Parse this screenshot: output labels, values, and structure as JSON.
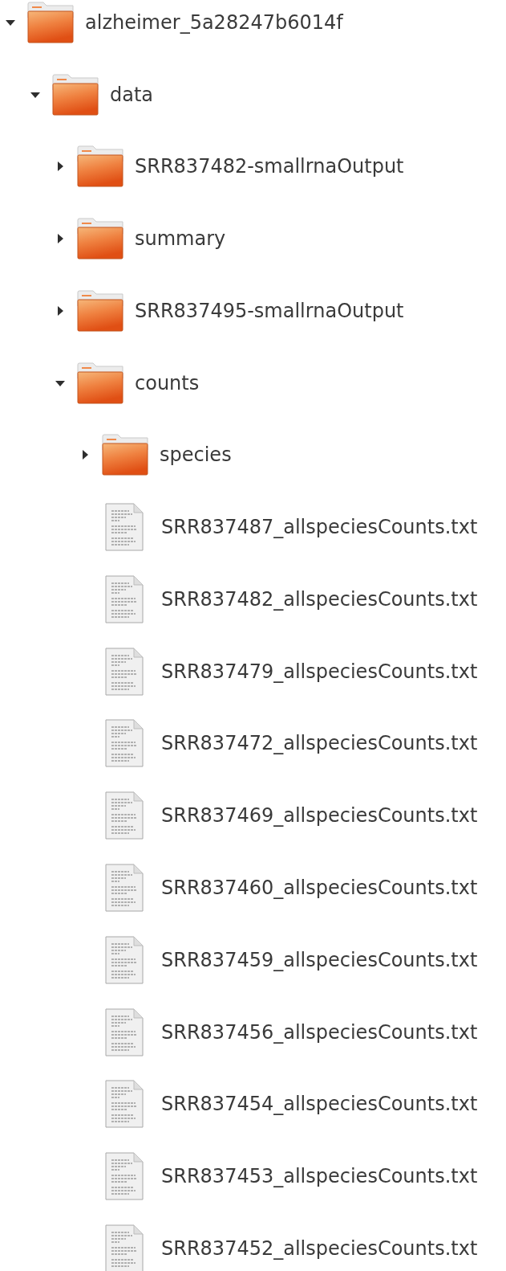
{
  "tree": [
    {
      "kind": "folder",
      "name": "alzheimer_5a28247b6014f",
      "expanded": true,
      "children": [
        {
          "kind": "folder",
          "name": "data",
          "expanded": true,
          "children": [
            {
              "kind": "folder",
              "name": "SRR837482-smallrnaOutput",
              "expanded": false
            },
            {
              "kind": "folder",
              "name": "summary",
              "expanded": false
            },
            {
              "kind": "folder",
              "name": "SRR837495-smallrnaOutput",
              "expanded": false
            },
            {
              "kind": "folder",
              "name": "counts",
              "expanded": true,
              "children": [
                {
                  "kind": "folder",
                  "name": "species",
                  "expanded": false
                },
                {
                  "kind": "file",
                  "name": "SRR837487_allspeciesCounts.txt"
                },
                {
                  "kind": "file",
                  "name": "SRR837482_allspeciesCounts.txt"
                },
                {
                  "kind": "file",
                  "name": "SRR837479_allspeciesCounts.txt"
                },
                {
                  "kind": "file",
                  "name": "SRR837472_allspeciesCounts.txt"
                },
                {
                  "kind": "file",
                  "name": "SRR837469_allspeciesCounts.txt"
                },
                {
                  "kind": "file",
                  "name": "SRR837460_allspeciesCounts.txt"
                },
                {
                  "kind": "file",
                  "name": "SRR837459_allspeciesCounts.txt"
                },
                {
                  "kind": "file",
                  "name": "SRR837456_allspeciesCounts.txt"
                },
                {
                  "kind": "file",
                  "name": "SRR837454_allspeciesCounts.txt"
                },
                {
                  "kind": "file",
                  "name": "SRR837453_allspeciesCounts.txt"
                },
                {
                  "kind": "file",
                  "name": "SRR837452_allspeciesCounts.txt"
                }
              ]
            }
          ]
        }
      ]
    }
  ]
}
